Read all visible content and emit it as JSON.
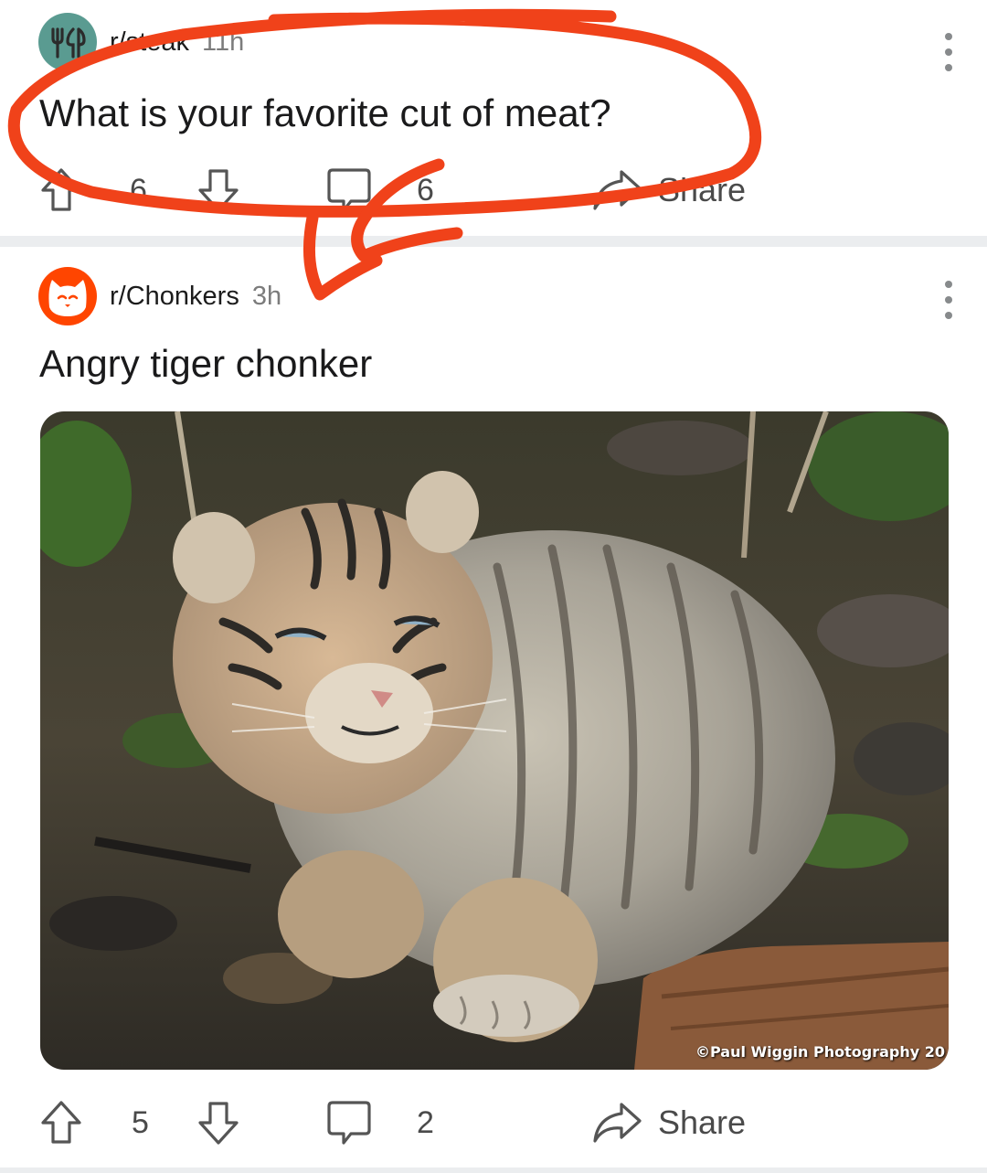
{
  "posts": [
    {
      "subreddit": "r/steak",
      "age": "11h",
      "title": "What is your favorite cut of meat?",
      "upvotes": "6",
      "comments": "6",
      "share_label": "Share",
      "avatar_icon": "fork-knife-icon",
      "avatar_color": "#5a9b91"
    },
    {
      "subreddit": "r/Chonkers",
      "age": "3h",
      "title": "Angry tiger chonker",
      "image_credit": "©Paul Wiggin Photography 20",
      "upvotes": "5",
      "comments": "2",
      "share_label": "Share",
      "avatar_icon": "cat-face-icon",
      "avatar_color": "#ff4500"
    }
  ],
  "annotation_color": "#f0421a"
}
